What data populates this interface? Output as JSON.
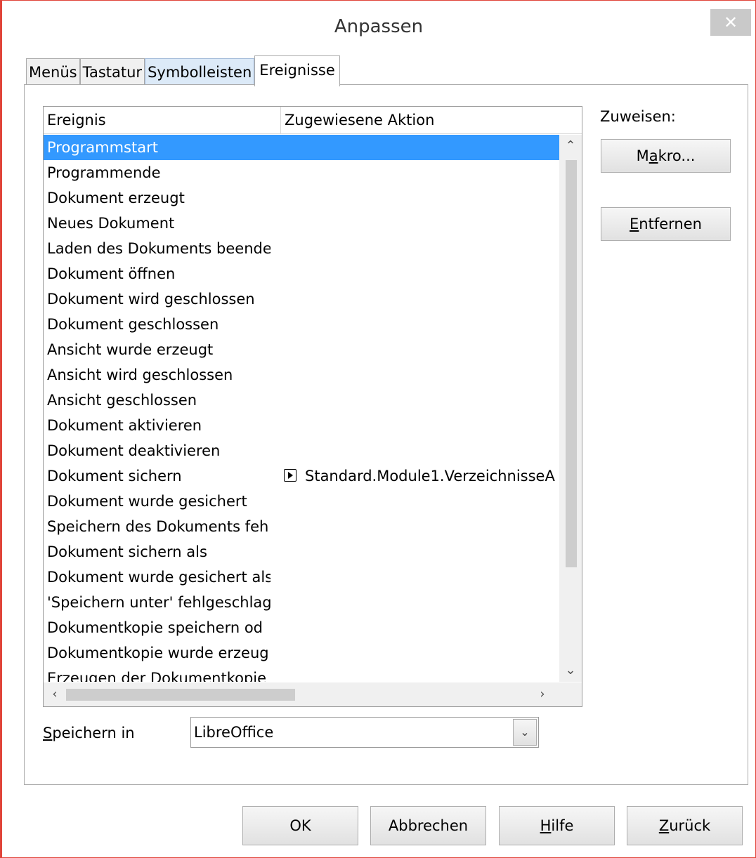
{
  "window": {
    "title": "Anpassen",
    "close_label": "✕"
  },
  "tabs": [
    {
      "label": "Menüs"
    },
    {
      "label": "Tastatur"
    },
    {
      "label": "Symbolleisten"
    },
    {
      "label": "Ereignisse"
    }
  ],
  "event_table": {
    "columns": [
      "Ereignis",
      "Zugewiesene Aktion"
    ],
    "rows": [
      {
        "event": "Programmstart",
        "action": "",
        "selected": true
      },
      {
        "event": "Programmende",
        "action": ""
      },
      {
        "event": "Dokument erzeugt",
        "action": ""
      },
      {
        "event": "Neues Dokument",
        "action": ""
      },
      {
        "event": "Laden des Dokuments beende",
        "action": ""
      },
      {
        "event": "Dokument öffnen",
        "action": ""
      },
      {
        "event": "Dokument wird geschlossen",
        "action": ""
      },
      {
        "event": "Dokument geschlossen",
        "action": ""
      },
      {
        "event": "Ansicht wurde erzeugt",
        "action": ""
      },
      {
        "event": "Ansicht wird geschlossen",
        "action": ""
      },
      {
        "event": "Ansicht geschlossen",
        "action": ""
      },
      {
        "event": "Dokument aktivieren",
        "action": ""
      },
      {
        "event": "Dokument deaktivieren",
        "action": ""
      },
      {
        "event": "Dokument sichern",
        "action": "Standard.Module1.VerzeichnisseA"
      },
      {
        "event": "Dokument wurde gesichert",
        "action": ""
      },
      {
        "event": "Speichern des Dokuments feh",
        "action": ""
      },
      {
        "event": "Dokument sichern als",
        "action": ""
      },
      {
        "event": "Dokument wurde gesichert als",
        "action": ""
      },
      {
        "event": "'Speichern unter' fehlgeschlag",
        "action": ""
      },
      {
        "event": "Dokumentkopie speichern od",
        "action": ""
      },
      {
        "event": "Dokumentkopie wurde erzeug",
        "action": ""
      },
      {
        "event": "Erzeugen der Dokumentkopie",
        "action": ""
      }
    ]
  },
  "assign": {
    "label": "Zuweisen:",
    "makro_pre": "M",
    "makro_accel": "a",
    "makro_post": "kro...",
    "entfernen_accel": "E",
    "entfernen_post": "ntfernen"
  },
  "save_in": {
    "label_accel": "S",
    "label_post": "peichern in",
    "value": "LibreOffice"
  },
  "buttons": {
    "ok": "OK",
    "cancel": "Abbrechen",
    "help_accel": "H",
    "help_post": "ilfe",
    "back_accel": "Z",
    "back_post": "urück"
  },
  "scroll_glyphs": {
    "up": "⌃",
    "down": "⌄",
    "left": "‹",
    "right": "›",
    "dropdown": "⌄"
  }
}
